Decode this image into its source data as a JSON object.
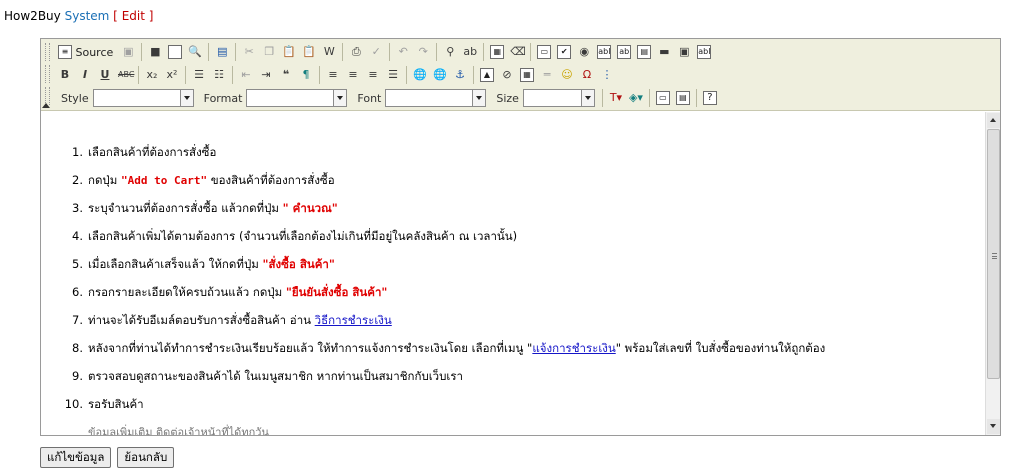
{
  "breadcrumb": {
    "site": "How2Buy",
    "section": "System",
    "open": "[",
    "action": "Edit",
    "close": "]"
  },
  "toolbar": {
    "source_label": "Source",
    "style_label": "Style",
    "format_label": "Format",
    "font_label": "Font",
    "size_label": "Size",
    "style_value": "",
    "format_value": "",
    "font_value": "",
    "size_value": ""
  },
  "steps": [
    {
      "num": "1.",
      "pre": "เลือกสินค้าที่ต้องการสั่งซื้อ"
    },
    {
      "num": "2.",
      "pre": "กดปุ่ม ",
      "hl": "\"Add to Cart\"",
      "post": " ของสินค้าที่ต้องการสั่งซื้อ"
    },
    {
      "num": "3.",
      "pre": "ระบุจำนวนที่ต้องการสั่งซื้อ แล้วกดที่ปุ่ม ",
      "hl": "\" คำนวณ\""
    },
    {
      "num": "4.",
      "pre": "เลือกสินค้าเพิ่มได้ตามต้องการ (จำนวนที่เลือกต้องไม่เกินที่มีอยู่ในคลังสินค้า ณ เวลานั้น)"
    },
    {
      "num": "5.",
      "pre": "เมื่อเลือกสินค้าเสร็จแล้ว ให้กดที่ปุ่ม ",
      "hl": "\"สั่งซื้อ สินค้า\""
    },
    {
      "num": "6.",
      "pre": "กรอกรายละเอียดให้ครบถ้วนแล้ว กดปุ่ม ",
      "hl": "\"ยืนยันสั่งซื้อ สินค้า\""
    },
    {
      "num": "7.",
      "pre": "ท่านจะได้รับอีเมล์ตอบรับการสั่งซื้อสินค้า อ่าน ",
      "link": "วิธีการชำระเงิน"
    },
    {
      "num": "8.",
      "pre": "หลังจากที่ท่านได้ทำการชำระเงินเรียบร้อยแล้ว ให้ทำการแจ้งการชำระเงินโดย เลือกที่เมนู \"",
      "link": "แจ้งการชำระเงิน",
      "post": "\" พร้อมใส่เลขที่ ใบสั่งซื้อของท่านให้ถูกต้อง"
    },
    {
      "num": "9.",
      "pre": "ตรวจสอบดูสถานะของสินค้าได้ ในเมนูสมาชิก หากท่านเป็นสมาชิกกับเว็บเรา"
    },
    {
      "num": "10.",
      "pre": "รอรับสินค้า"
    }
  ],
  "partial_line": "ข้อมูลเพิ่มเติม ติดต่อเจ้าหน้าที่ได้ทุกวัน",
  "buttons": {
    "edit": "แก้ไขข้อมูล",
    "back": "ย้อนกลับ"
  }
}
